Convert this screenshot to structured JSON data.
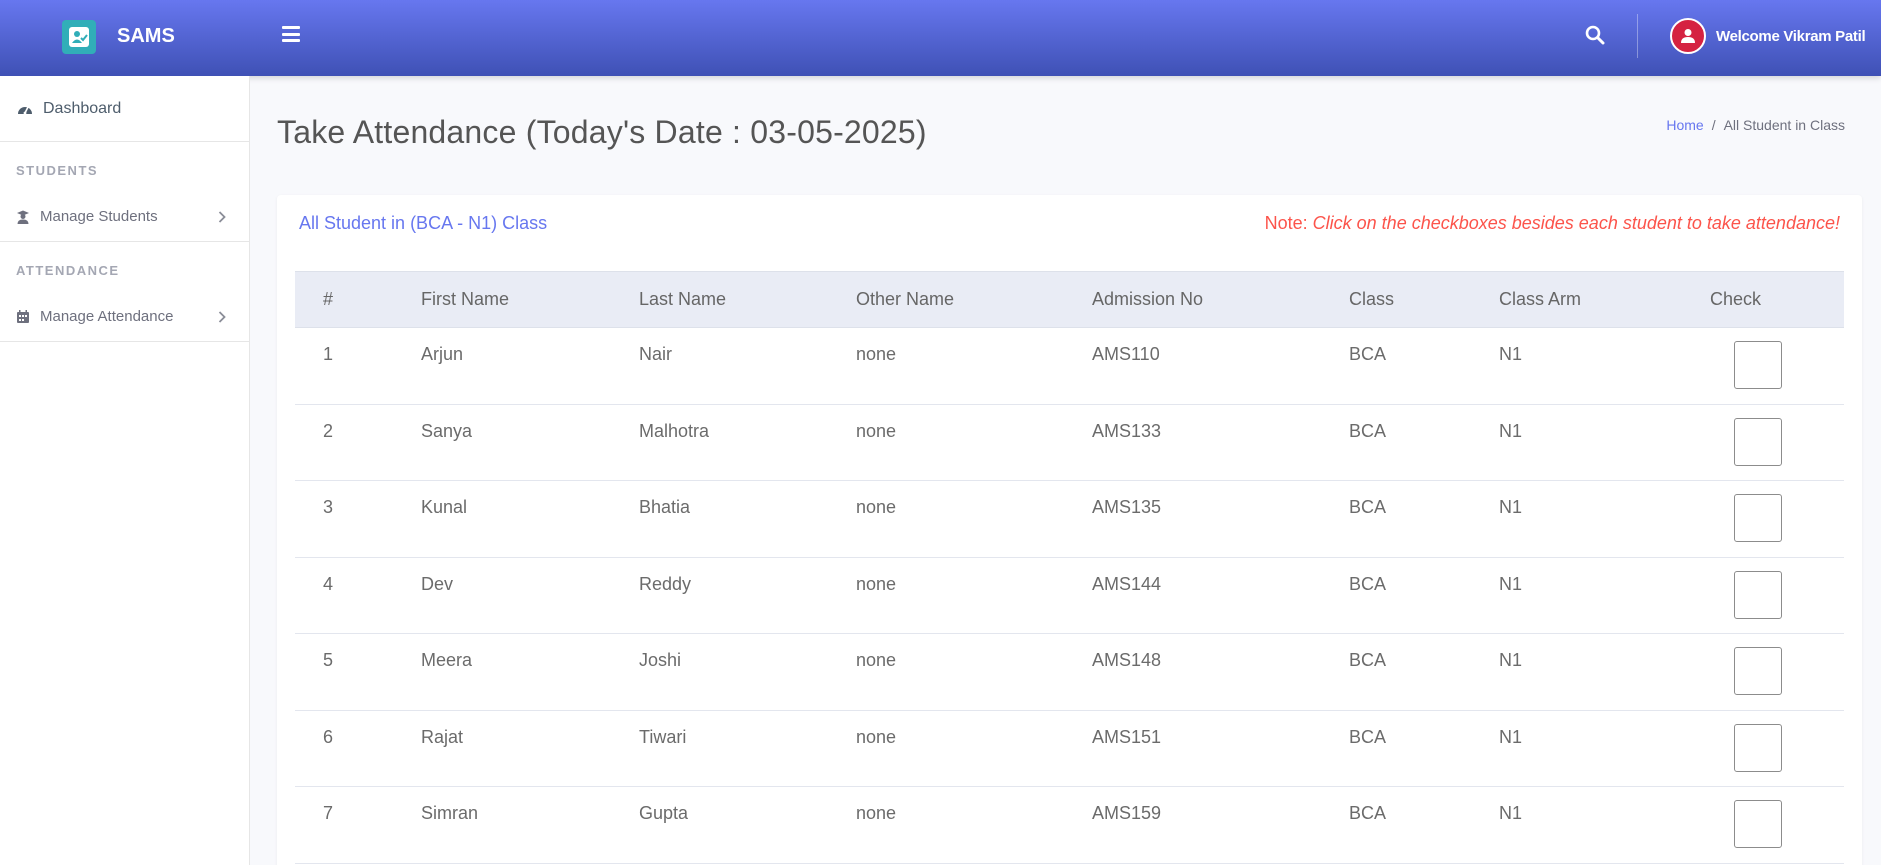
{
  "app": {
    "brand": "SAMS",
    "user_greeting": "Welcome Vikram Patil"
  },
  "sidebar": {
    "dashboard_label": "Dashboard",
    "sections": [
      {
        "heading": "STUDENTS",
        "item_label": "Manage Students"
      },
      {
        "heading": "ATTENDANCE",
        "item_label": "Manage Attendance"
      }
    ]
  },
  "page": {
    "title": "Take Attendance (Today's Date : 03-05-2025)",
    "breadcrumb": {
      "home": "Home",
      "separator": "/",
      "current": "All Student in Class"
    }
  },
  "card": {
    "title": "All Student in (BCA - N1) Class",
    "note_label": "Note:",
    "note_text": "Click on the checkboxes besides each student to take attendance!"
  },
  "table": {
    "headers": [
      "#",
      "First Name",
      "Last Name",
      "Other Name",
      "Admission No",
      "Class",
      "Class Arm",
      "Check"
    ],
    "rows": [
      {
        "num": "1",
        "first": "Arjun",
        "last": "Nair",
        "other": "none",
        "adm": "AMS110",
        "class": "BCA",
        "arm": "N1"
      },
      {
        "num": "2",
        "first": "Sanya",
        "last": "Malhotra",
        "other": "none",
        "adm": "AMS133",
        "class": "BCA",
        "arm": "N1"
      },
      {
        "num": "3",
        "first": "Kunal",
        "last": "Bhatia",
        "other": "none",
        "adm": "AMS135",
        "class": "BCA",
        "arm": "N1"
      },
      {
        "num": "4",
        "first": "Dev",
        "last": "Reddy",
        "other": "none",
        "adm": "AMS144",
        "class": "BCA",
        "arm": "N1"
      },
      {
        "num": "5",
        "first": "Meera",
        "last": "Joshi",
        "other": "none",
        "adm": "AMS148",
        "class": "BCA",
        "arm": "N1"
      },
      {
        "num": "6",
        "first": "Rajat",
        "last": "Tiwari",
        "other": "none",
        "adm": "AMS151",
        "class": "BCA",
        "arm": "N1"
      },
      {
        "num": "7",
        "first": "Simran",
        "last": "Gupta",
        "other": "none",
        "adm": "AMS159",
        "class": "BCA",
        "arm": "N1"
      }
    ]
  },
  "colors": {
    "topbar_start": "#6777ef",
    "topbar_end": "#3f51b5",
    "brand_icon_bg": "#31aeb8",
    "avatar_bg": "#d52241",
    "link": "#6777ef",
    "note": "#fc544b",
    "table_header_bg": "#e9ecf5"
  },
  "icons": {
    "brand": "user-check-icon",
    "menu": "hamburger-icon",
    "search": "search-icon",
    "avatar": "user-icon",
    "dashboard": "tachometer-icon",
    "students": "user-graduate-icon",
    "attendance": "calendar-icon",
    "chevron": "chevron-right-icon"
  }
}
